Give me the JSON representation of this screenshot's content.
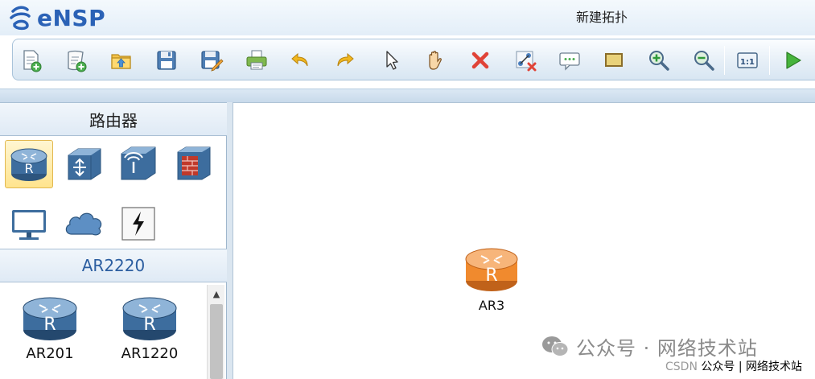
{
  "app": {
    "logo_text": "eNSP",
    "window_title": "新建拓扑"
  },
  "toolbar": {
    "buttons": [
      {
        "name": "new-topology",
        "icon": "new-file-icon"
      },
      {
        "name": "new-lab",
        "icon": "new-lab-icon"
      },
      {
        "name": "open",
        "icon": "open-folder-icon"
      },
      {
        "name": "save",
        "icon": "save-icon"
      },
      {
        "name": "save-as",
        "icon": "save-as-icon"
      },
      {
        "name": "print",
        "icon": "print-icon"
      },
      {
        "name": "undo",
        "icon": "undo-icon"
      },
      {
        "name": "redo",
        "icon": "redo-icon"
      },
      {
        "name": "select",
        "icon": "pointer-icon"
      },
      {
        "name": "pan",
        "icon": "hand-icon"
      },
      {
        "name": "delete",
        "icon": "delete-icon"
      },
      {
        "name": "delete-link",
        "icon": "delete-link-icon"
      },
      {
        "name": "text-note",
        "icon": "comment-icon"
      },
      {
        "name": "rectangle",
        "icon": "rectangle-icon"
      },
      {
        "name": "zoom-in",
        "icon": "zoom-in-icon"
      },
      {
        "name": "zoom-out",
        "icon": "zoom-out-icon"
      },
      {
        "name": "actual-size",
        "icon": "actual-size-icon"
      },
      {
        "name": "start-devices",
        "icon": "play-icon"
      }
    ]
  },
  "palette": {
    "category_title": "路由器",
    "categories": [
      {
        "name": "router",
        "icon": "router-icon",
        "selected": true
      },
      {
        "name": "switch",
        "icon": "switch-icon",
        "selected": false
      },
      {
        "name": "wlan",
        "icon": "wireless-ap-icon",
        "selected": false
      },
      {
        "name": "firewall",
        "icon": "firewall-icon",
        "selected": false
      },
      {
        "name": "pc",
        "icon": "monitor-icon",
        "selected": false
      },
      {
        "name": "cloud",
        "icon": "cloud-icon",
        "selected": false
      },
      {
        "name": "link",
        "icon": "connection-icon",
        "selected": false
      }
    ],
    "model_title": "AR2220",
    "models": [
      {
        "label": "AR201",
        "icon": "router-icon"
      },
      {
        "label": "AR1220",
        "icon": "router-icon"
      }
    ]
  },
  "canvas": {
    "devices": [
      {
        "label": "AR3",
        "icon": "router-icon",
        "color": "#f08a2e"
      }
    ]
  },
  "watermark": {
    "main": "公众号 · 网络技术站",
    "footer_prefix": "CSDN",
    "footer_text": "公众号 | 网络技术站"
  },
  "colors": {
    "router_blue": "#3d6d9e",
    "router_orange": "#f08a2e",
    "brand_blue": "#2b62b6"
  }
}
